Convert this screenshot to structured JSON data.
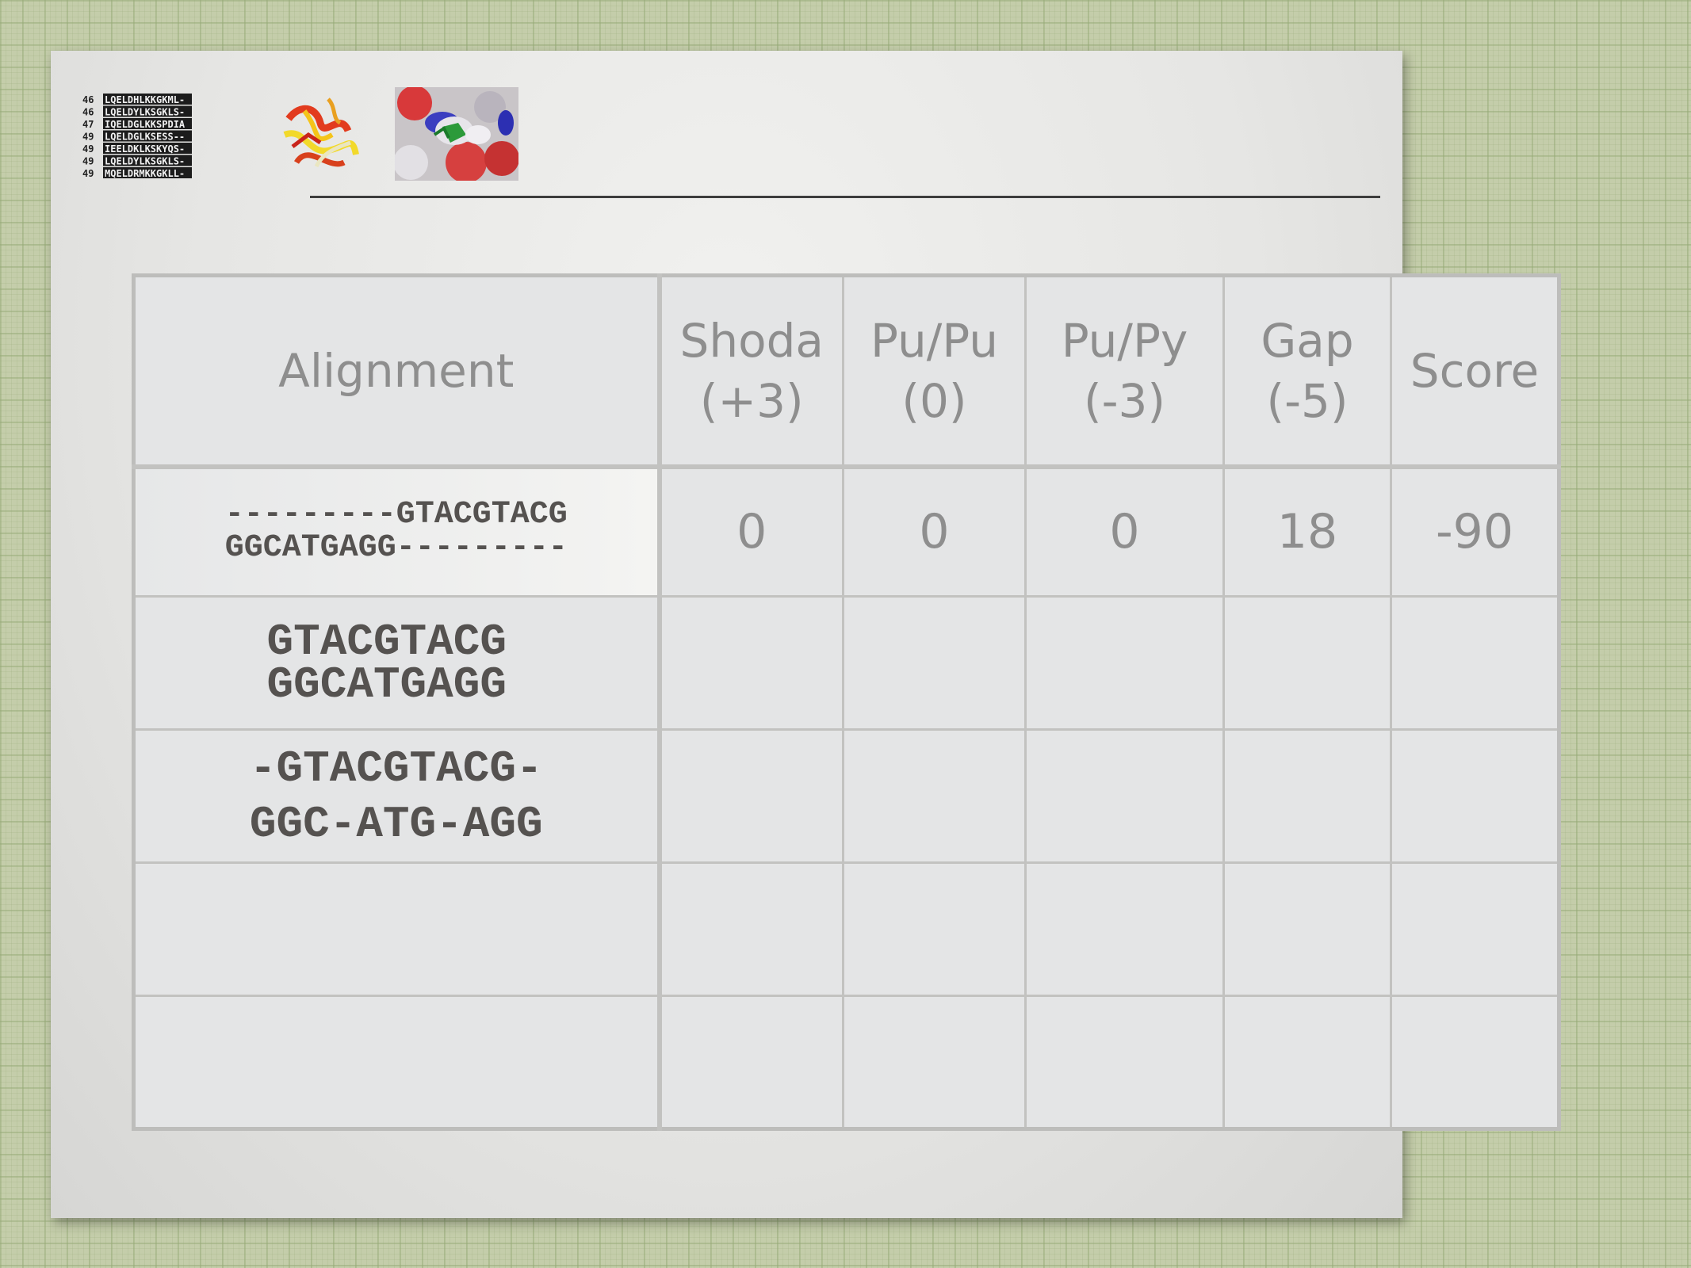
{
  "icons": {
    "sequence_alignment_thumb": "sequence-alignment-thumbnail",
    "protein_ribbon_thumb": "protein-ribbon-structure-thumbnail",
    "protein_surface_thumb": "protein-surface-thumbnail"
  },
  "sequence_thumb": {
    "rows": [
      {
        "num": "46",
        "seq": "LQELDHLKKGKML-"
      },
      {
        "num": "46",
        "seq": "LQELDYLKSGKLS-"
      },
      {
        "num": "47",
        "seq": "IQELDGLKKSPDIA"
      },
      {
        "num": "49",
        "seq": "LQELDGLKSESS--"
      },
      {
        "num": "49",
        "seq": "IEELDKLKSKYQS-"
      },
      {
        "num": "49",
        "seq": "LQELDYLKSGKLS-"
      },
      {
        "num": "49",
        "seq": "MQELDRMKKGKLL-"
      }
    ]
  },
  "table": {
    "headers": [
      {
        "line1": "Alignment",
        "line2": ""
      },
      {
        "line1": "Shoda",
        "line2": "(+3)"
      },
      {
        "line1": "Pu/Pu",
        "line2": "(0)"
      },
      {
        "line1": "Pu/Py",
        "line2": "(-3)"
      },
      {
        "line1": "Gap",
        "line2": "(-5)"
      },
      {
        "line1": "Score",
        "line2": ""
      }
    ],
    "rows": [
      {
        "alignment_top": "---------GTACGTACG",
        "alignment_bottom": "GGCATGAGG---------",
        "shoda": "0",
        "pupu": "0",
        "pupy": "0",
        "gap": "18",
        "score": "-90"
      },
      {
        "alignment_top": "GTACGTACG",
        "alignment_bottom": "GGCATGAGG",
        "shoda": "",
        "pupu": "",
        "pupy": "",
        "gap": "",
        "score": ""
      },
      {
        "alignment_top": "-GTACGTACG-",
        "alignment_bottom": "GGC-ATG-AGG",
        "shoda": "",
        "pupu": "",
        "pupy": "",
        "gap": "",
        "score": ""
      },
      {
        "alignment_top": "",
        "alignment_bottom": "",
        "shoda": "",
        "pupu": "",
        "pupy": "",
        "gap": "",
        "score": ""
      },
      {
        "alignment_top": "",
        "alignment_bottom": "",
        "shoda": "",
        "pupu": "",
        "pupy": "",
        "gap": "",
        "score": ""
      }
    ]
  },
  "colors": {
    "background_grid": "#c4cdaa",
    "slide": "#e6e6e4",
    "header_text": "#8e8e8e",
    "alignment_text": "#555250",
    "table_border": "#c2c2c0"
  }
}
